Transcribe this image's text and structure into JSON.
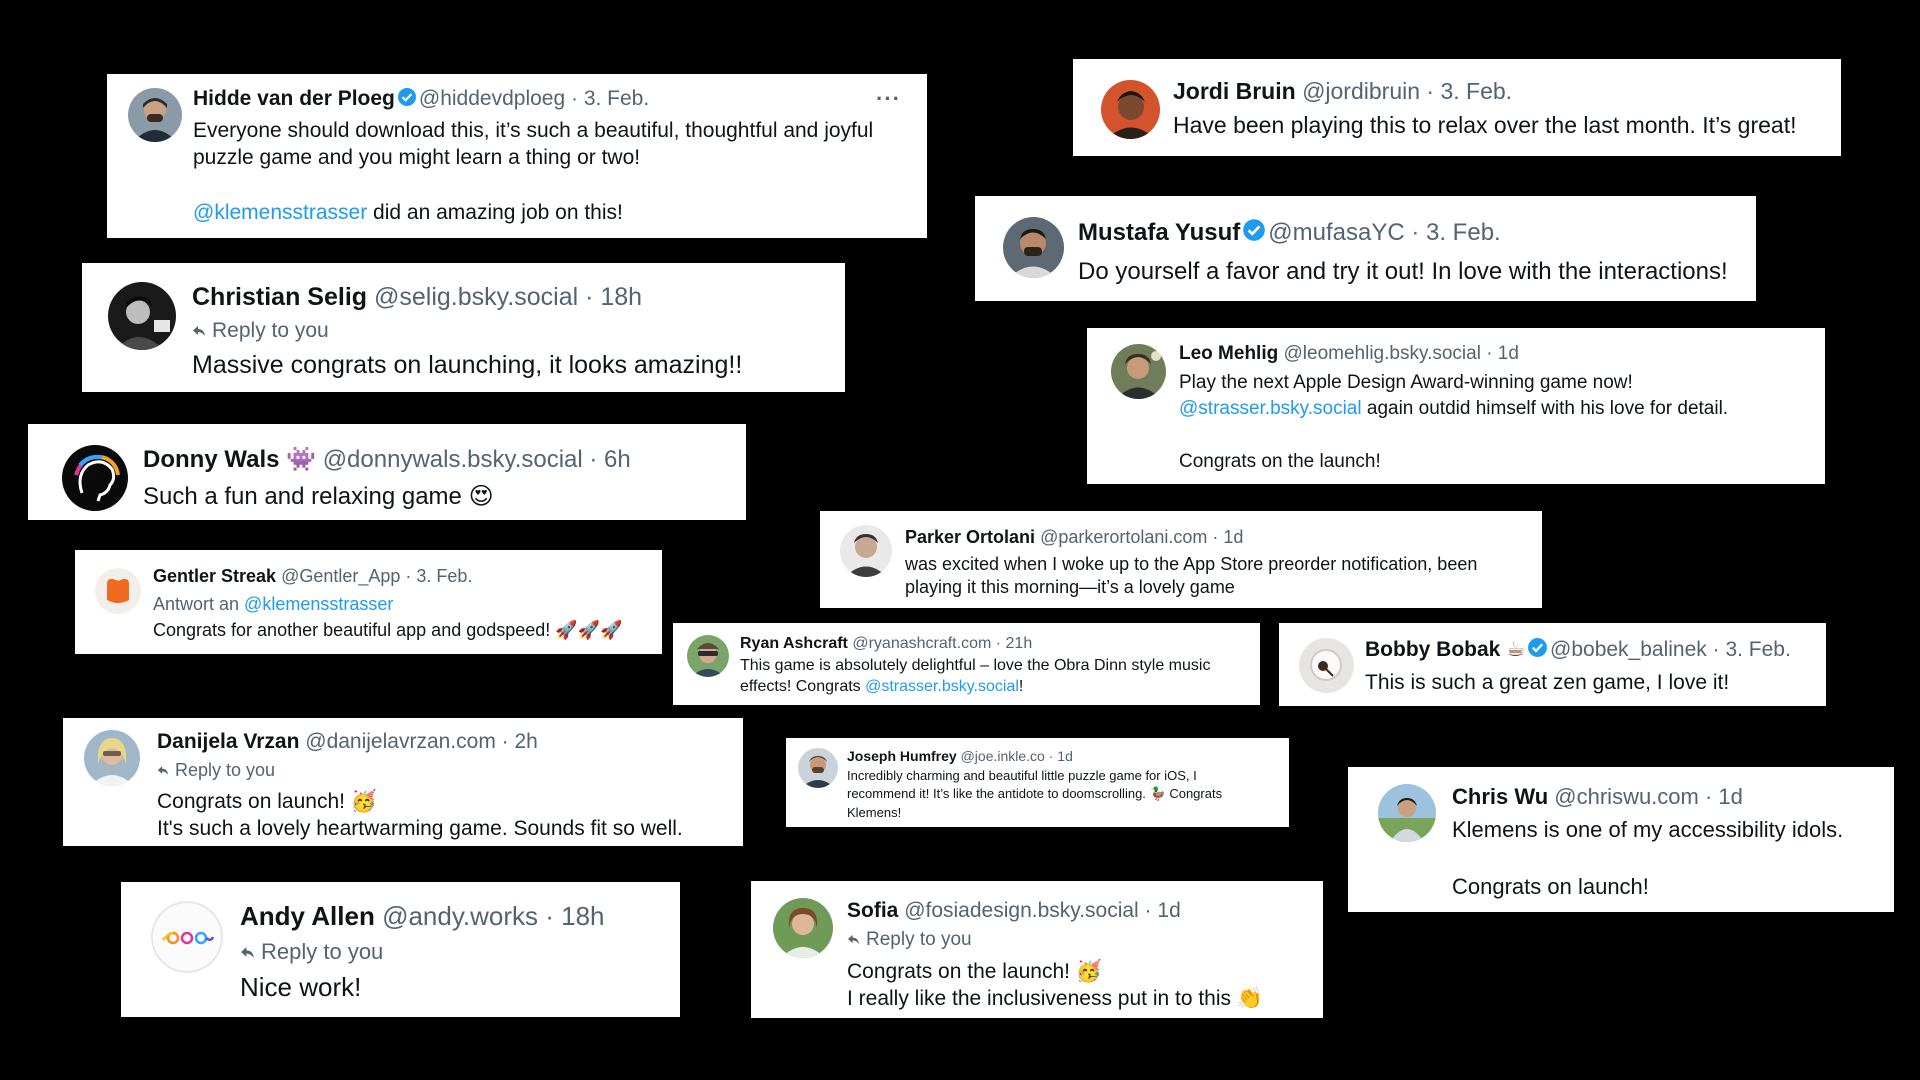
{
  "cards": {
    "hidde": {
      "name": "Hidde van der Ploeg",
      "handle": "@hiddevdploeg · 3. Feb.",
      "line1": "Everyone should download this, it’s such a beautiful, thoughtful and joyful",
      "line2": "puzzle game and you might learn a thing or two!",
      "mention": "@klemensstrasser",
      "after_mention": " did an amazing job on this!",
      "more": "···"
    },
    "jordi": {
      "name": "Jordi Bruin",
      "handle": "@jordibruin · 3. Feb.",
      "text": "Have been playing this to relax over the last month. It’s great!"
    },
    "christian": {
      "name": "Christian Selig",
      "handle": "@selig.bsky.social · 18h",
      "reply": "Reply to you",
      "text": "Massive congrats on launching, it looks amazing!!"
    },
    "mustafa": {
      "name": "Mustafa Yusuf",
      "handle": "@mufasaYC · 3. Feb.",
      "text": "Do yourself a favor and try it out! In love with the interactions!"
    },
    "leo": {
      "name": "Leo Mehlig",
      "handle": "@leomehlig.bsky.social · 1d",
      "line1": "Play the next Apple Design Award-winning game now!",
      "mention": "@strasser.bsky.social",
      "after_mention": " again outdid himself with his love for detail.",
      "line3": "Congrats on the launch!"
    },
    "donny": {
      "name": "Donny Wals",
      "emoji": "👾",
      "handle": "@donnywals.bsky.social · 6h",
      "text": "Such a fun and relaxing game",
      "text_emoji": "😍"
    },
    "parker": {
      "name": "Parker Ortolani",
      "handle": "@parkerortolani.com · 1d",
      "line1": "was excited when I woke up to the App Store preorder notification, been",
      "line2": "playing it this morning—it’s a lovely game"
    },
    "gentler": {
      "name": "Gentler Streak",
      "handle": "@Gentler_App · 3. Feb.",
      "antwort": "Antwort an ",
      "antwort_mention": "@klemensstrasser",
      "text": "Congrats for another beautiful app and godspeed!",
      "text_emoji": "🚀🚀🚀"
    },
    "ryan": {
      "name": "Ryan Ashcraft",
      "handle": "@ryanashcraft.com · 21h",
      "line1": "This game is absolutely delightful – love the Obra Dinn style music",
      "line2_pre": "effects! Congrats ",
      "mention": "@strasser.bsky.social",
      "line2_post": "!"
    },
    "bobby": {
      "name": "Bobby Bobak",
      "emoji": "☕",
      "handle": "@bobek_balinek · 3. Feb.",
      "text": "This is such a great zen game, I love it!"
    },
    "danijela": {
      "name": "Danijela Vrzan",
      "handle": "@danijelavrzan.com · 2h",
      "reply": "Reply to you",
      "line1": "Congrats on launch!",
      "line1_emoji": "🥳",
      "line2": "It's such a lovely heartwarming game. Sounds fit so well."
    },
    "joseph": {
      "name": "Joseph Humfrey",
      "handle": "@joe.inkle.co · 1d",
      "line1": "Incredibly charming and beautiful little puzzle game for iOS, I",
      "line2": "recommend it! It’s like the antidote to doomscrolling.",
      "line2_emoji": "🦆",
      "line2_post": " Congrats",
      "line3": "Klemens!"
    },
    "chris": {
      "name": "Chris Wu",
      "handle": "@chriswu.com · 1d",
      "line1": "Klemens is one of my accessibility idols.",
      "line2": "Congrats on launch!"
    },
    "andy": {
      "name": "Andy Allen",
      "handle": "@andy.works · 18h",
      "reply": "Reply to you",
      "text": "Nice work!"
    },
    "sofia": {
      "name": "Sofia",
      "handle": "@fosiadesign.bsky.social · 1d",
      "reply": "Reply to you",
      "line1": "Congrats on the launch!",
      "line1_emoji": "🥳",
      "line2": "I really like the inclusiveness put in to this",
      "line2_emoji": "👏"
    }
  },
  "colors": {
    "background": "#000000",
    "card": "#ffffff",
    "link": "#1d9bf0",
    "meta": "#536471",
    "verified": "#1d9bf0"
  }
}
